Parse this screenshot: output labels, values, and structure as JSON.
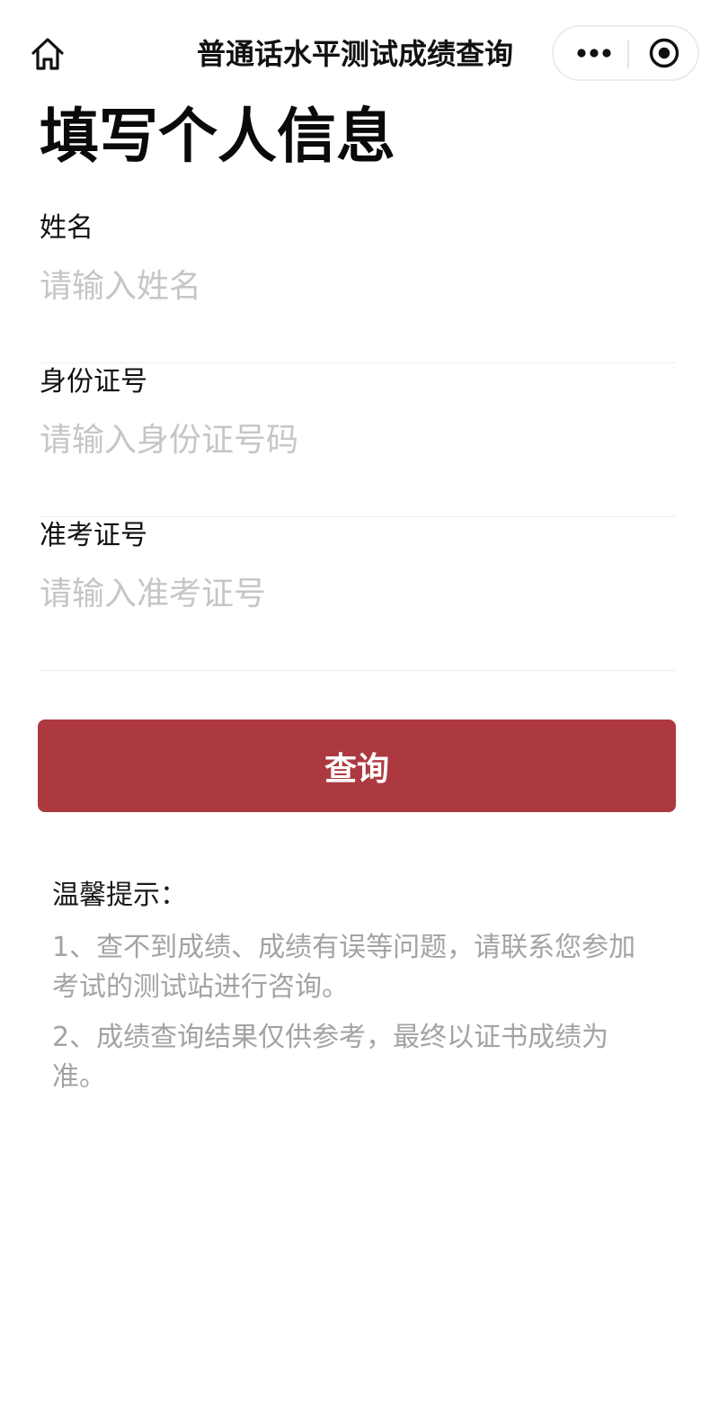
{
  "nav": {
    "title": "普通话水平测试成绩查询",
    "icons": {
      "home": "home-icon",
      "more": "more-dots-icon",
      "close": "target-circle-icon"
    }
  },
  "page": {
    "title": "填写个人信息"
  },
  "form": {
    "fields": [
      {
        "label": "姓名",
        "placeholder": "请输入姓名",
        "value": ""
      },
      {
        "label": "身份证号",
        "placeholder": "请输入身份证号码",
        "value": ""
      },
      {
        "label": "准考证号",
        "placeholder": "请输入准考证号",
        "value": ""
      }
    ],
    "submit_label": "查询"
  },
  "tips": {
    "title": "温馨提示：",
    "items": [
      "1、查不到成绩、成绩有误等问题，请联系您参加考试的测试站进行咨询。",
      "2、成绩查询结果仅供参考，最终以证书成绩为准。"
    ]
  },
  "colors": {
    "accent": "#ad3940",
    "placeholder": "#c6c6c6",
    "tip_text": "#a3a3a3",
    "divider": "#ededed"
  }
}
